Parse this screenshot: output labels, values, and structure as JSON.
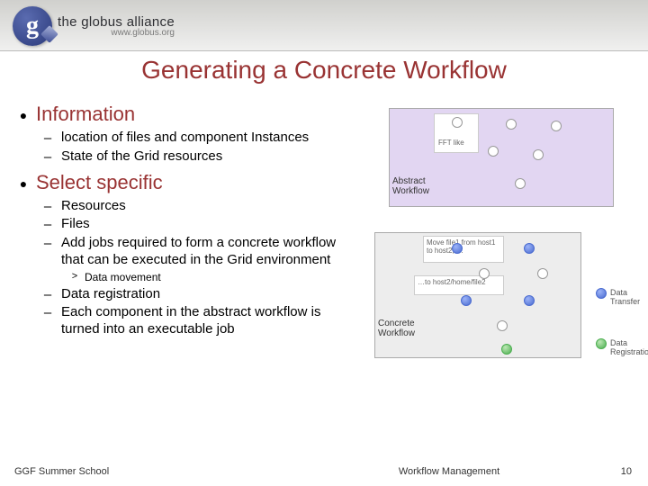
{
  "logo": {
    "glyph": "g",
    "title": "the globus alliance",
    "subtitle": "www.globus.org"
  },
  "title": "Generating a Concrete Workflow",
  "sections": {
    "info": {
      "heading": "Information",
      "items": [
        "location of files and component Instances",
        "State of the Grid resources"
      ]
    },
    "select": {
      "heading": "Select specific",
      "items": {
        "a": "Resources",
        "b": "Files",
        "c": "Add jobs required to form a concrete workflow that can be executed in the Grid environment",
        "c_sub": "Data movement",
        "d": "Data registration",
        "e": "Each component in the abstract workflow is turned into an executable job"
      }
    }
  },
  "diagram": {
    "abstract_label": "Abstract\nWorkflow",
    "card1": "FFT  like",
    "concrete_label": "Concrete\nWorkflow",
    "txt1": "Move file1 from host1 to host2; …",
    "txt2": "…to host2/home/file2",
    "legend1": "Data Transfer",
    "legend2": "Data Registration"
  },
  "footer": {
    "left": "GGF Summer School",
    "center": "Workflow Management",
    "page": "10"
  }
}
